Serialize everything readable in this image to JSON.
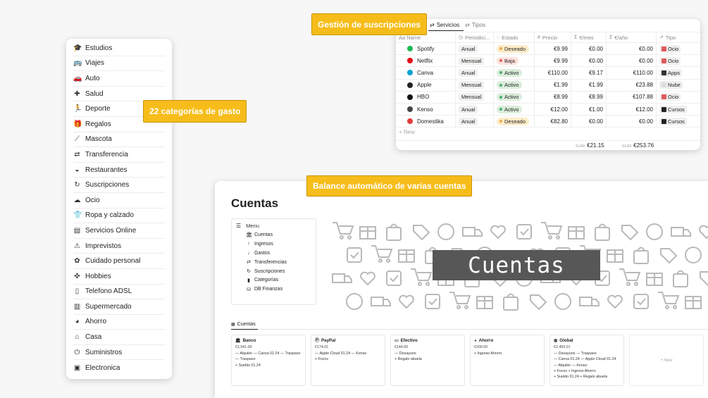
{
  "callouts": {
    "categories": "22 categorías de gasto",
    "subscriptions": "Gestión de suscripciones",
    "accounts": "Balance automático de varias cuentas"
  },
  "categories": [
    {
      "label": "Estudios",
      "icon": "graduation-cap-icon"
    },
    {
      "label": "Viajes",
      "icon": "bus-icon"
    },
    {
      "label": "Auto",
      "icon": "car-icon"
    },
    {
      "label": "Salud",
      "icon": "medical-kit-icon"
    },
    {
      "label": "Deporte",
      "icon": "runner-icon"
    },
    {
      "label": "Regalos",
      "icon": "gift-icon"
    },
    {
      "label": "Mascota",
      "icon": "bone-icon"
    },
    {
      "label": "Transferencia",
      "icon": "swap-arrows-icon"
    },
    {
      "label": "Restaurantes",
      "icon": "serving-dish-icon"
    },
    {
      "label": "Suscripciones",
      "icon": "refresh-icon"
    },
    {
      "label": "Ocio",
      "icon": "cloud-icon"
    },
    {
      "label": "Ropa y calzado",
      "icon": "clothing-icon"
    },
    {
      "label": "Servicios Online",
      "icon": "server-icon"
    },
    {
      "label": "Imprevistos",
      "icon": "alert-icon"
    },
    {
      "label": "Cuidado personal",
      "icon": "care-icon"
    },
    {
      "label": "Hobbies",
      "icon": "puzzle-icon"
    },
    {
      "label": "Telefono ADSL",
      "icon": "phone-icon"
    },
    {
      "label": "Supermercado",
      "icon": "store-icon"
    },
    {
      "label": "Ahorro",
      "icon": "piggy-bank-icon"
    },
    {
      "label": "Casa",
      "icon": "house-icon"
    },
    {
      "label": "Suministros",
      "icon": "plug-icon"
    },
    {
      "label": "Electronica",
      "icon": "chip-icon"
    }
  ],
  "subscriptions": {
    "tabs": [
      {
        "label": "Servicios",
        "icon": "swap-icon",
        "active": true
      },
      {
        "label": "Tipos",
        "icon": "swap-icon",
        "active": false
      }
    ],
    "columns": [
      {
        "label": "Aa Name",
        "icon": ""
      },
      {
        "label": "Periodici...",
        "icon": "clock-icon"
      },
      {
        "label": "Estado",
        "icon": "status-icon"
      },
      {
        "label": "Precio",
        "icon": "hash-icon"
      },
      {
        "label": "€/mes",
        "icon": "sigma-icon"
      },
      {
        "label": "€/año",
        "icon": "sigma-icon"
      },
      {
        "label": "Tipo",
        "icon": "relation-icon"
      }
    ],
    "rows": [
      {
        "name": "Spotify",
        "logo_color": "#1db954",
        "period": "Anual",
        "status": "Deseado",
        "status_color": "#f0a84b",
        "status_bg": "#fdecc8",
        "price": "€9.99",
        "month": "€0.00",
        "year": "€0.00",
        "type": "Ocio",
        "type_color": "#e05a5a"
      },
      {
        "name": "Netflix",
        "logo_color": "#e50914",
        "period": "Mensual",
        "status": "Baja",
        "status_color": "#e16259",
        "status_bg": "#ffe2dd",
        "price": "€9.99",
        "month": "€0.00",
        "year": "€0.00",
        "type": "Ocio",
        "type_color": "#e05a5a"
      },
      {
        "name": "Canva",
        "logo_color": "#00a2d6",
        "period": "Anual",
        "status": "Activo",
        "status_color": "#4dab6f",
        "status_bg": "#dbeddb",
        "price": "€110.00",
        "month": "€9.17",
        "year": "€110.00",
        "type": "Apps",
        "type_color": "#333333"
      },
      {
        "name": "Apple",
        "logo_color": "#222222",
        "period": "Mensual",
        "status": "Activo",
        "status_color": "#4dab6f",
        "status_bg": "#dbeddb",
        "price": "€1.99",
        "month": "€1.99",
        "year": "€23.88",
        "type": "Nube",
        "type_color": "#dddddd"
      },
      {
        "name": "HBO",
        "logo_color": "#111111",
        "period": "Mensual",
        "status": "Activo",
        "status_color": "#4dab6f",
        "status_bg": "#dbeddb",
        "price": "€8.99",
        "month": "€8.99",
        "year": "€107.88",
        "type": "Ocio",
        "type_color": "#e05a5a"
      },
      {
        "name": "Kenso",
        "logo_color": "#444444",
        "period": "Anual",
        "status": "Activo",
        "status_color": "#4dab6f",
        "status_bg": "#dbeddb",
        "price": "€12.00",
        "month": "€1.00",
        "year": "€12.00",
        "type": "Cursos",
        "type_color": "#222222"
      },
      {
        "name": "Domestika",
        "logo_color": "#e33b3b",
        "period": "Anual",
        "status": "Deseado",
        "status_color": "#f0a84b",
        "status_bg": "#fdecc8",
        "price": "€82.80",
        "month": "€0.00",
        "year": "€0.00",
        "type": "Cursos",
        "type_color": "#222222"
      }
    ],
    "new_label": "+ New",
    "sum_label": "SUM",
    "sum_month": "€21.15",
    "sum_year": "€253.76"
  },
  "accounts_page": {
    "title": "Cuentas",
    "menu_title": "Menu",
    "menu_items": [
      {
        "label": "Cuentas",
        "icon": "bank-icon"
      },
      {
        "label": "Ingresos",
        "icon": "arrow-up-icon"
      },
      {
        "label": "Gastos",
        "icon": "arrow-down-icon"
      },
      {
        "label": "Transferencias",
        "icon": "swap-icon"
      },
      {
        "label": "Suscripciones",
        "icon": "refresh-icon"
      },
      {
        "label": "Categorías",
        "icon": "bookmark-icon"
      },
      {
        "label": "DB Finanzas",
        "icon": "database-icon"
      }
    ],
    "banner_text": "Cuentas",
    "tab_label": "Cuentas",
    "accounts": [
      {
        "name": "Banco",
        "icon": "bank-icon",
        "balance": "€1,941.00",
        "lines": [
          "— Alquiler — Canva 01.24 — Traspaso",
          "— Traspaso",
          "+ Sueldo 01.24"
        ]
      },
      {
        "name": "PayPal",
        "icon": "paypal-icon",
        "balance": "€174.01",
        "lines": [
          "— Apple Cloud 01.24 — Kenso",
          "+ Focos"
        ]
      },
      {
        "name": "Efectivo",
        "icon": "cash-icon",
        "balance": "€144.00",
        "lines": [
          "— Desayuno",
          "+ Regalo abuela"
        ]
      },
      {
        "name": "Ahorro",
        "icon": "piggy-bank-icon",
        "balance": "€200.00",
        "lines": [
          "+ Ingreso Ahorro"
        ]
      },
      {
        "name": "Global",
        "icon": "globe-icon",
        "balance": "€2,459.01",
        "lines": [
          "— Desayuno — Traspaso",
          "— Canva 01.24 — Apple Cloud 01.24",
          "— Alquiler — Kenso",
          "+ Focos + Ingreso Ahorro",
          "+ Sueldo 01.24 + Regalo abuela"
        ]
      }
    ],
    "new_label": "+ New"
  }
}
